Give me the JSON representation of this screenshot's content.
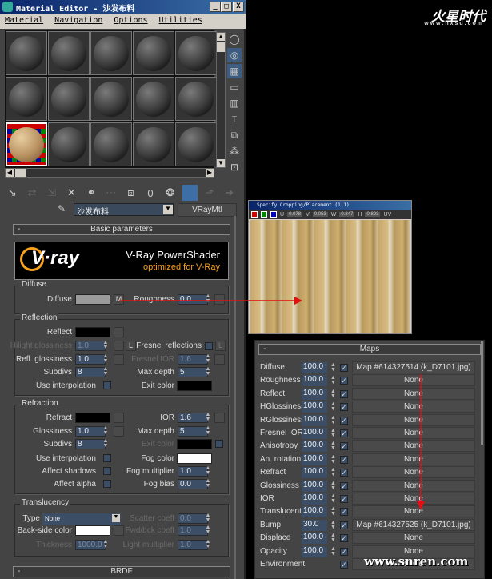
{
  "window": {
    "title": "Material Editor - 沙发布料",
    "min": "_",
    "max": "□",
    "close": "X"
  },
  "menu": [
    "Material",
    "Navigation",
    "Options",
    "Utilities"
  ],
  "material": {
    "name": "沙发布料",
    "type": "VRayMtl"
  },
  "rollouts": {
    "basic": "Basic parameters",
    "brdf": "BRDF",
    "maps": "Maps"
  },
  "banner": {
    "logo": "V·ray",
    "title": "V-Ray PowerShader",
    "subtitle": "optimized for V-Ray"
  },
  "diffuse": {
    "group": "Diffuse",
    "label": "Diffuse",
    "map_btn": "M",
    "roughness_label": "Roughness",
    "roughness": "0.0",
    "color": "#9a9a9a"
  },
  "reflection": {
    "group": "Reflection",
    "reflect": "Reflect",
    "hilight_label": "Hilight glossiness",
    "hilight": "1.0",
    "lock": "L",
    "fresnel_label": "Fresnel reflections",
    "fresnel_lock": "L",
    "refl_gloss_label": "Refl. glossiness",
    "refl_gloss": "1.0",
    "fresnel_ior_label": "Fresnel IOR",
    "fresnel_ior": "1.6",
    "subdivs_label": "Subdivs",
    "subdivs": "8",
    "max_depth_label": "Max depth",
    "max_depth": "5",
    "interp_label": "Use interpolation",
    "exit_label": "Exit color"
  },
  "refraction": {
    "group": "Refraction",
    "refract": "Refract",
    "ior_label": "IOR",
    "ior": "1.6",
    "gloss_label": "Glossiness",
    "gloss": "1.0",
    "max_depth_label": "Max depth",
    "max_depth": "5",
    "subdivs_label": "Subdivs",
    "subdivs": "8",
    "exit_label": "Exit color",
    "interp_label": "Use interpolation",
    "fog_color_label": "Fog color",
    "shadows_label": "Affect shadows",
    "fog_mult_label": "Fog multiplier",
    "fog_mult": "1.0",
    "alpha_label": "Affect alpha",
    "fog_bias_label": "Fog bias",
    "fog_bias": "0.0"
  },
  "translucency": {
    "group": "Translucency",
    "type_label": "Type",
    "type": "None",
    "scatter_label": "Scatter coeff",
    "scatter": "0.0",
    "backside_label": "Back-side color",
    "fwd_label": "Fwd/bck coeff",
    "fwd": "1.0",
    "thickness_label": "Thickness",
    "thickness": "1000.0",
    "light_label": "Light multiplier",
    "light": "1.0"
  },
  "crop": {
    "title": "Specify Cropping/Placement (1:1)",
    "u_label": "U",
    "u": "0.078",
    "v_label": "V",
    "v": "0.053",
    "w_label": "W",
    "w": "0.847",
    "h_label": "H",
    "h": "0.893",
    "uv": "UV"
  },
  "maps": [
    {
      "label": "Diffuse",
      "value": "100.0",
      "map": "Map #614327514 (k_D7101.jpg)"
    },
    {
      "label": "Roughness",
      "value": "100.0",
      "map": "None"
    },
    {
      "label": "Reflect",
      "value": "100.0",
      "map": "None"
    },
    {
      "label": "HGlossiness",
      "value": "100.0",
      "map": "None"
    },
    {
      "label": "RGlossiness",
      "value": "100.0",
      "map": "None"
    },
    {
      "label": "Fresnel IOR",
      "value": "100.0",
      "map": "None"
    },
    {
      "label": "Anisotropy",
      "value": "100.0",
      "map": "None"
    },
    {
      "label": "An. rotation",
      "value": "100.0",
      "map": "None"
    },
    {
      "label": "Refract",
      "value": "100.0",
      "map": "None"
    },
    {
      "label": "Glossiness",
      "value": "100.0",
      "map": "None"
    },
    {
      "label": "IOR",
      "value": "100.0",
      "map": "None"
    },
    {
      "label": "Translucent",
      "value": "100.0",
      "map": "None"
    },
    {
      "label": "Bump",
      "value": "30.0",
      "map": "Map #614327525 (k_D7101.jpg)"
    },
    {
      "label": "Displace",
      "value": "100.0",
      "map": "None"
    },
    {
      "label": "Opacity",
      "value": "100.0",
      "map": "None"
    },
    {
      "label": "Environment",
      "value": "",
      "map": "None"
    }
  ],
  "branding": {
    "logo": "火星时代",
    "logo_url": "www.hxsd.com",
    "watermark": "www.snren.com"
  },
  "colors": {
    "accent": "#3d6ea5",
    "arrow": "#e01010"
  }
}
